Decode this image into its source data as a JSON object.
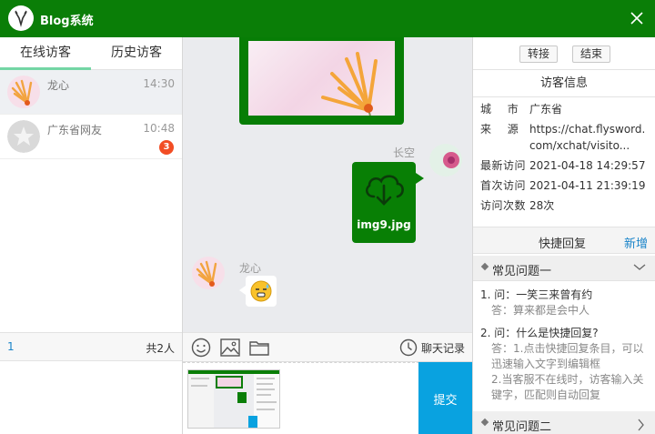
{
  "window": {
    "title": "Blog系统"
  },
  "tabs": {
    "online": "在线访客",
    "history": "历史访客"
  },
  "visitors": [
    {
      "name": "龙心",
      "time": "14:30"
    },
    {
      "name": "广东省网友",
      "time": "10:48",
      "badge": "3"
    }
  ],
  "left_footer": {
    "page": "1",
    "total": "共2人"
  },
  "chat": {
    "agent_name": "长空",
    "file_name": "img9.jpg",
    "user_name": "龙心"
  },
  "toolbar": {
    "history_label": "聊天记录"
  },
  "input": {
    "submit_label": "提交"
  },
  "actions": {
    "transfer": "转接",
    "end": "结束"
  },
  "visitor_info": {
    "title": "访客信息",
    "rows": [
      {
        "key": "城    市",
        "value": "广东省"
      },
      {
        "key": "来    源",
        "value": "https://chat.flysword.com/xchat/visito..."
      },
      {
        "key": "最新访问",
        "value": "2021-04-18 14:29:57"
      },
      {
        "key": "首次访问",
        "value": "2021-04-11 21:39:19"
      },
      {
        "key": "访问次数",
        "value": "28次"
      }
    ]
  },
  "quick_reply": {
    "title": "快捷回复",
    "add_label": "新增",
    "groups": [
      {
        "title": "常见问题一"
      },
      {
        "title": "常见问题二"
      }
    ],
    "items": [
      {
        "q": "1. 问：一笑三来曾有约",
        "a": "答：算来都是会中人"
      },
      {
        "q": "2. 问：什么是快捷回复?",
        "a": "答：1.点击快捷回复条目，可以迅速输入文字到编辑框\n2.当客服不在线时，访客输入关键字，匹配则自动回复"
      }
    ]
  },
  "colors": {
    "brand_green": "#0a7e07",
    "submit_blue": "#09a2e0",
    "badge_red": "#f24d24",
    "link_blue": "#1a84c9"
  }
}
